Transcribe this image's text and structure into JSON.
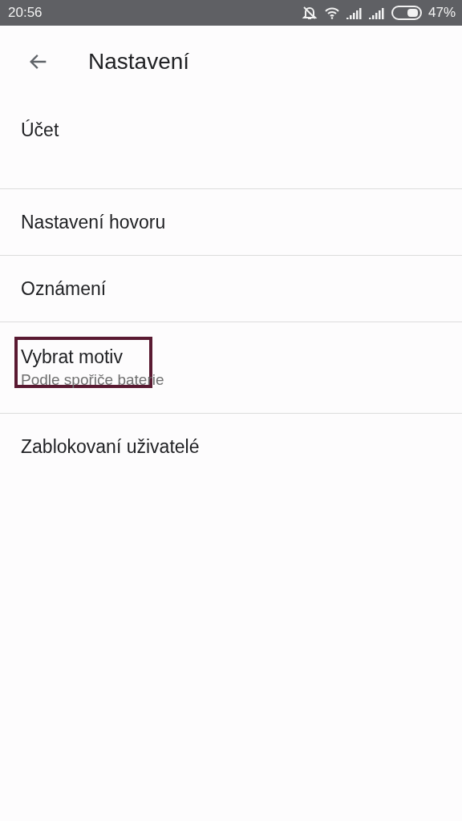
{
  "status_bar": {
    "time": "20:56",
    "battery": "47%"
  },
  "header": {
    "title": "Nastavení"
  },
  "items": [
    {
      "kind": "account",
      "title": "Účet",
      "highlighted": false
    },
    {
      "kind": "setting",
      "title": "Nastavení hovoru",
      "highlighted": false
    },
    {
      "kind": "setting",
      "title": "Oznámení",
      "highlighted": false
    },
    {
      "kind": "setting",
      "title": "Vybrat motiv",
      "subtitle": "Podle spořiče baterie",
      "highlighted": true
    },
    {
      "kind": "setting",
      "title": "Zablokovaní uživatelé",
      "highlighted": false
    }
  ]
}
